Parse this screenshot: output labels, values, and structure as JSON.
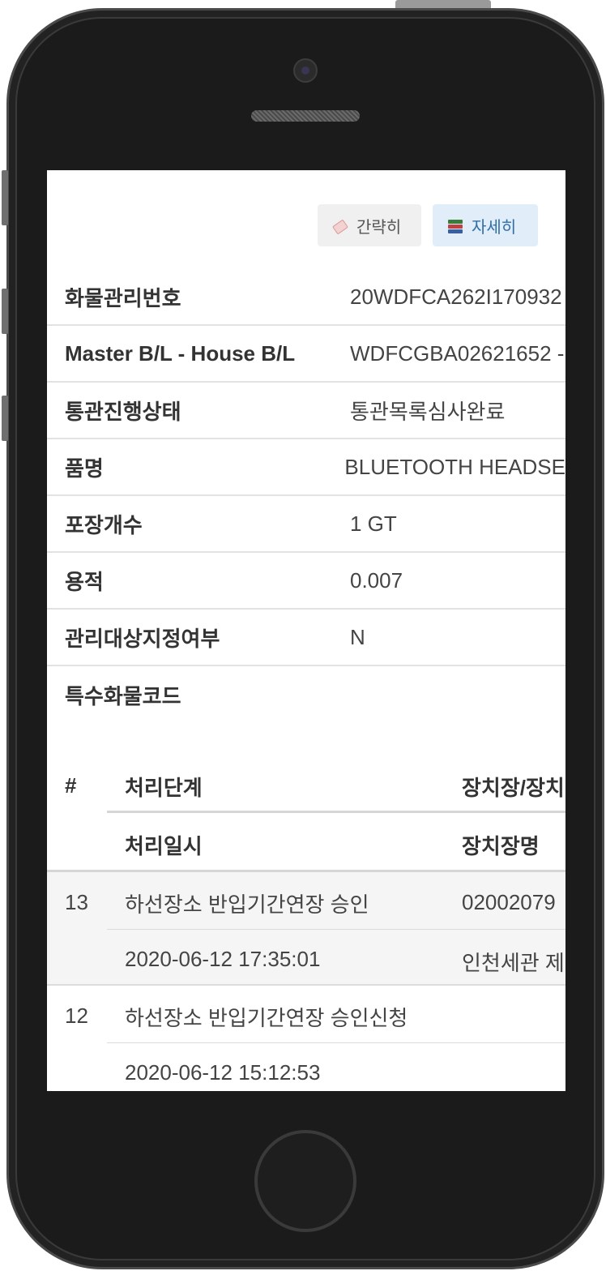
{
  "toggles": {
    "simple_label": "간략히",
    "detail_label": "자세히"
  },
  "cargo_info": [
    {
      "label": "화물관리번호",
      "value": "20WDFCA262I170932"
    },
    {
      "label": "Master B/L - House B/L",
      "value": "WDFCGBA02621652 -"
    },
    {
      "label": "통관진행상태",
      "value": "통관목록심사완료"
    },
    {
      "label": "품명",
      "value": "BLUETOOTH HEADSE"
    },
    {
      "label": "포장개수",
      "value": "1 GT"
    },
    {
      "label": "용적",
      "value": "0.007"
    },
    {
      "label": "관리대상지정여부",
      "value": "N"
    },
    {
      "label": "특수화물코드",
      "value": ""
    }
  ],
  "tracking": {
    "headers": {
      "num": "#",
      "step": "처리단계",
      "location": "장치장/장치",
      "datetime": "처리일시",
      "location_name": "장치장명"
    },
    "entries": [
      {
        "num": "13",
        "step": "하선장소 반입기간연장 승인",
        "location": "02002079",
        "datetime": "2020-06-12 17:35:01",
        "location_name": "인천세관 제"
      },
      {
        "num": "12",
        "step": "하선장소 반입기간연장 승인신청",
        "location": "",
        "datetime": "2020-06-12 15:12:53",
        "location_name": ""
      }
    ]
  }
}
